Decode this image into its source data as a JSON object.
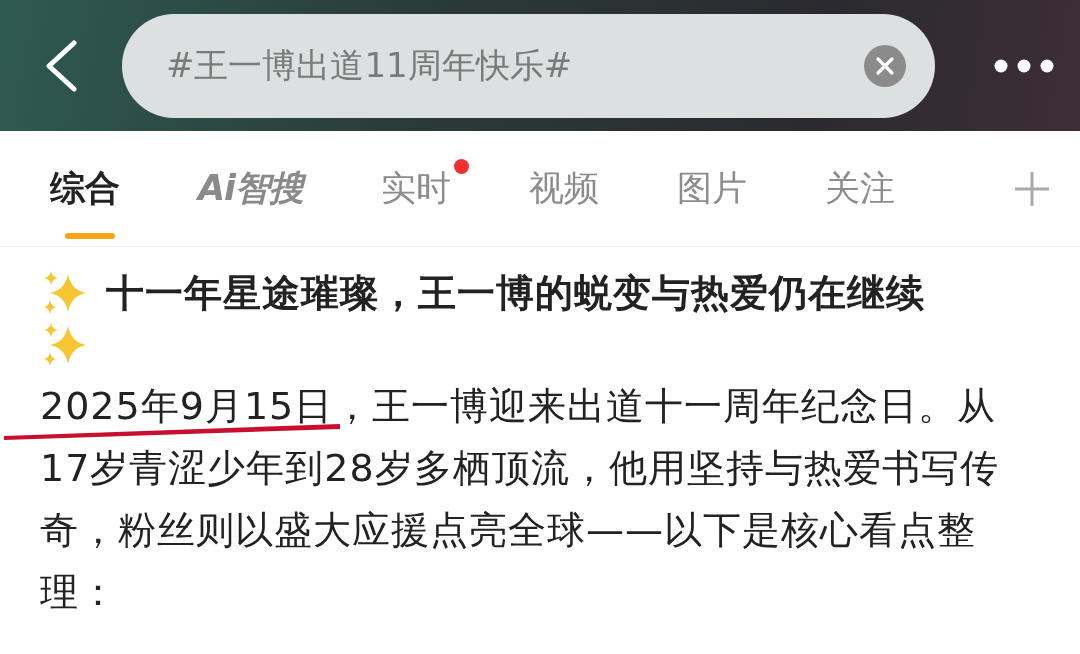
{
  "search": {
    "value": "#王一博出道11周年快乐#"
  },
  "tabs": [
    {
      "label": "综合",
      "selected": true,
      "kind": "text",
      "dot": false
    },
    {
      "label": "Ai智搜",
      "selected": false,
      "kind": "logo",
      "dot": false
    },
    {
      "label": "实时",
      "selected": false,
      "kind": "text",
      "dot": true
    },
    {
      "label": "视频",
      "selected": false,
      "kind": "text",
      "dot": false
    },
    {
      "label": "图片",
      "selected": false,
      "kind": "text",
      "dot": false
    },
    {
      "label": "关注",
      "selected": false,
      "kind": "text",
      "dot": false
    }
  ],
  "post": {
    "title": "十一年星途璀璨，王一博的蜕变与热爱仍在继续",
    "body": [
      {
        "text": "2025年9月15日",
        "underlined": true
      },
      {
        "text": "，王一博迎来出道十一周年纪念日。从17岁青涩少年到28岁多栖顶流，他用坚持与热爱书写传奇，粉丝则以盛大应援点亮全球——以下是核心看点整理：",
        "underlined": false
      }
    ]
  }
}
